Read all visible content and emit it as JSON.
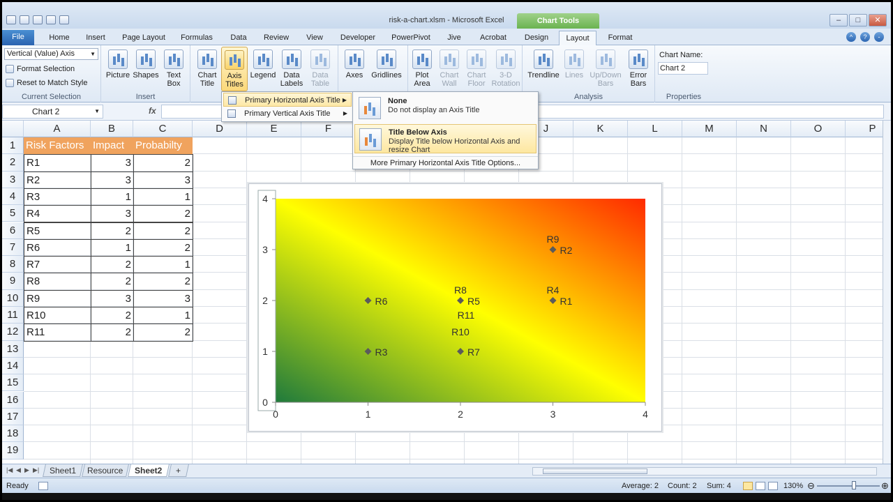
{
  "window": {
    "title": "risk-a-chart.xlsm - Microsoft Excel",
    "context_tab": "Chart Tools",
    "buttons": [
      "–",
      "□",
      "✕"
    ]
  },
  "tabs": [
    {
      "label": "File",
      "left": 0
    },
    {
      "label": "Home"
    },
    {
      "label": "Insert"
    },
    {
      "label": "Page Layout"
    },
    {
      "label": "Formulas"
    },
    {
      "label": "Data"
    },
    {
      "label": "Review"
    },
    {
      "label": "View"
    },
    {
      "label": "Developer"
    },
    {
      "label": "PowerPivot"
    },
    {
      "label": "Jive"
    },
    {
      "label": "Acrobat"
    },
    {
      "label": "Design"
    },
    {
      "label": "Layout"
    },
    {
      "label": "Format"
    }
  ],
  "ribbon": {
    "current_selection": {
      "dropdown": "Vertical (Value) Axis",
      "format_selection": "Format Selection",
      "reset": "Reset to Match Style",
      "label": "Current Selection"
    },
    "insert": {
      "picture": "Picture",
      "shapes": "Shapes",
      "textbox": "Text Box",
      "label": "Insert"
    },
    "labels": {
      "chart_title": "Chart Title",
      "axis_titles": "Axis Titles",
      "legend": "Legend",
      "data_labels": "Data Labels",
      "data_table": "Data Table"
    },
    "axes": {
      "axes": "Axes",
      "gridlines": "Gridlines"
    },
    "background": {
      "plot_area": "Plot Area",
      "chart_wall": "Chart Wall",
      "chart_floor": "Chart Floor",
      "rotation": "3-D Rotation"
    },
    "analysis": {
      "trendline": "Trendline",
      "lines": "Lines",
      "updown": "Up/Down Bars",
      "error": "Error Bars",
      "label": "Analysis"
    },
    "properties": {
      "name_label": "Chart Name:",
      "name_value": "Chart 2",
      "label": "Properties"
    }
  },
  "formula_bar": {
    "name_box": "Chart 2",
    "fx": "fx"
  },
  "columns": [
    "A",
    "B",
    "C",
    "D",
    "E",
    "F",
    "G",
    "H",
    "I",
    "J",
    "K",
    "L",
    "M",
    "N",
    "O",
    "P"
  ],
  "rows": [
    "1",
    "2",
    "3",
    "4",
    "5",
    "6",
    "7",
    "8",
    "9",
    "10",
    "11",
    "12",
    "13",
    "14",
    "15",
    "16",
    "17",
    "18",
    "19"
  ],
  "table": {
    "headers": [
      "Risk Factors",
      "Impact",
      "Probabilty"
    ],
    "rows": [
      [
        "R1",
        "3",
        "2"
      ],
      [
        "R2",
        "3",
        "3"
      ],
      [
        "R3",
        "1",
        "1"
      ],
      [
        "R4",
        "3",
        "2"
      ],
      [
        "R5",
        "2",
        "2"
      ],
      [
        "R6",
        "1",
        "2"
      ],
      [
        "R7",
        "2",
        "1"
      ],
      [
        "R8",
        "2",
        "2"
      ],
      [
        "R9",
        "3",
        "3"
      ],
      [
        "R10",
        "2",
        "1"
      ],
      [
        "R11",
        "2",
        "2"
      ]
    ]
  },
  "menu_axis_titles": {
    "items": [
      "Primary Horizontal Axis Title",
      "Primary Vertical Axis Title"
    ]
  },
  "submenu": {
    "none_title": "None",
    "none_desc": "Do not display an Axis Title",
    "below_title": "Title Below Axis",
    "below_desc": "Display Title below Horizontal Axis and resize Chart",
    "more": "More Primary Horizontal Axis Title Options..."
  },
  "chart_data": {
    "type": "scatter",
    "xlim": [
      0,
      4
    ],
    "ylim": [
      0,
      4
    ],
    "x_ticks": [
      "0",
      "1",
      "2",
      "3",
      "4"
    ],
    "y_ticks": [
      "0",
      "1",
      "2",
      "3",
      "4"
    ],
    "points": [
      {
        "label": "R1",
        "x": 3,
        "y": 2
      },
      {
        "label": "R2",
        "x": 3,
        "y": 3
      },
      {
        "label": "R3",
        "x": 1,
        "y": 1
      },
      {
        "label": "R4",
        "x": 3,
        "y": 2
      },
      {
        "label": "R5",
        "x": 2,
        "y": 2
      },
      {
        "label": "R6",
        "x": 1,
        "y": 2
      },
      {
        "label": "R7",
        "x": 2,
        "y": 1
      },
      {
        "label": "R8",
        "x": 2,
        "y": 2
      },
      {
        "label": "R9",
        "x": 3,
        "y": 3
      },
      {
        "label": "R10",
        "x": 2,
        "y": 1
      },
      {
        "label": "R11",
        "x": 2,
        "y": 2
      }
    ],
    "point_color": "#5b5b5b",
    "background_gradient": [
      "#1f7a3c",
      "#ffff00",
      "#ff2a00"
    ]
  },
  "sheets": {
    "tabs": [
      "Sheet1",
      "Resource",
      "Sheet2"
    ],
    "active": "Sheet2"
  },
  "status": {
    "ready": "Ready",
    "average": "Average: 2",
    "count": "Count: 2",
    "sum": "Sum: 4",
    "zoom": "130%"
  }
}
